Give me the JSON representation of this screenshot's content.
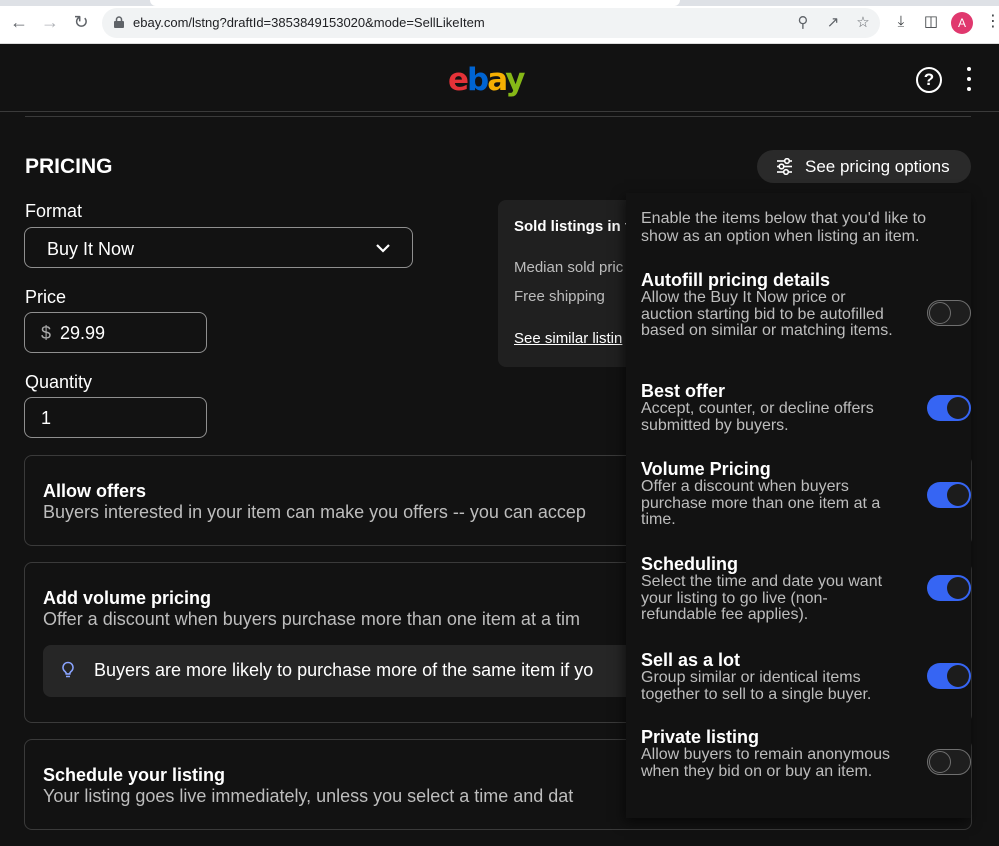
{
  "browser": {
    "url": "ebay.com/lstng?draftId=3853849153020&mode=SellLikeItem",
    "profile_initial": "A"
  },
  "header": {
    "help_label": "?"
  },
  "pricing": {
    "title": "PRICING",
    "options_button": "See pricing options",
    "format_label": "Format",
    "format_value": "Buy It Now",
    "price_label": "Price",
    "currency": "$",
    "price_value": "29.99",
    "quantity_label": "Quantity",
    "quantity_value": "1"
  },
  "sold_panel": {
    "title": "Sold listings in t",
    "median": "Median sold pric",
    "shipping": "Free shipping",
    "link": "See similar listin"
  },
  "cards": {
    "offers_title": "Allow offers",
    "offers_sub": "Buyers interested in your item can make you offers -- you can accep",
    "volume_title": "Add volume pricing",
    "volume_sub": "Offer a discount when buyers purchase more than one item at a tim",
    "volume_tip": "Buyers are more likely to purchase more of the same item if yo",
    "schedule_title": "Schedule your listing",
    "schedule_sub": "Your listing goes live immediately, unless you select a time and dat"
  },
  "options_panel": {
    "intro": "Enable the items below that you'd like to show as an option when listing an item.",
    "items": [
      {
        "title": "Autofill pricing details",
        "desc": "Allow the Buy It Now price or auction starting bid to be autofilled based on similar or matching items.",
        "enabled": false
      },
      {
        "title": "Best offer",
        "desc": "Accept, counter, or decline offers submitted by buyers.",
        "enabled": true
      },
      {
        "title": "Volume Pricing",
        "desc": "Offer a discount when buyers purchase more than one item at a time.",
        "enabled": true
      },
      {
        "title": "Scheduling",
        "desc": "Select the time and date you want your listing to go live (non-refundable fee applies).",
        "enabled": true
      },
      {
        "title": "Sell as a lot",
        "desc": "Group similar or identical items together to sell to a single buyer.",
        "enabled": true
      },
      {
        "title": "Private listing",
        "desc": "Allow buyers to remain anonymous when they bid on or buy an item.",
        "enabled": false
      }
    ]
  },
  "colors": {
    "accent": "#3665f3",
    "background": "#121212"
  }
}
